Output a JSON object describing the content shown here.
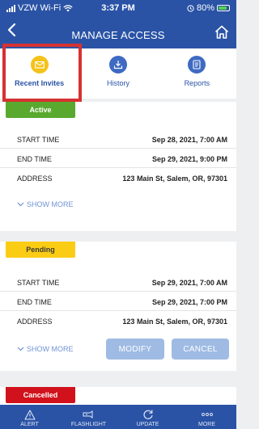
{
  "status_bar": {
    "carrier": "VZW Wi-Fi",
    "time": "3:37 PM",
    "battery": "80%"
  },
  "header": {
    "title": "MANAGE ACCESS",
    "back_icon": "chevron-left-icon",
    "home_icon": "home-icon"
  },
  "tabs": [
    {
      "label": "Recent Invites",
      "icon": "envelope-icon",
      "active": true,
      "color": "#f4c21a"
    },
    {
      "label": "History",
      "icon": "download-icon",
      "active": false,
      "color": "#3e6ac2"
    },
    {
      "label": "Reports",
      "icon": "document-icon",
      "active": false,
      "color": "#3e6ac2"
    }
  ],
  "invites": [
    {
      "status": "Active",
      "status_color": "#58a92e",
      "rows": [
        {
          "label": "START TIME",
          "value": "Sep 28, 2021, 7:00 AM"
        },
        {
          "label": "END TIME",
          "value": "Sep 29, 2021, 9:00 PM"
        },
        {
          "label": "ADDRESS",
          "value": "123 Main St, Salem, OR, 97301"
        }
      ],
      "show_more": "SHOW MORE"
    },
    {
      "status": "Pending",
      "status_color": "#fbcc14",
      "rows": [
        {
          "label": "START TIME",
          "value": "Sep 29, 2021, 7:00 AM"
        },
        {
          "label": "END TIME",
          "value": "Sep 29, 2021, 7:00 PM"
        },
        {
          "label": "ADDRESS",
          "value": "123 Main St, Salem, OR, 97301"
        }
      ],
      "show_more": "SHOW MORE",
      "modify_label": "MODIFY",
      "cancel_label": "CANCEL"
    },
    {
      "status": "Cancelled",
      "status_color": "#d1121c"
    }
  ],
  "bottom_nav": [
    {
      "label": "ALERT",
      "icon": "warning-icon"
    },
    {
      "label": "FLASHLIGHT",
      "icon": "flashlight-icon"
    },
    {
      "label": "UPDATE",
      "icon": "refresh-icon"
    },
    {
      "label": "MORE",
      "icon": "more-dots-icon"
    }
  ]
}
